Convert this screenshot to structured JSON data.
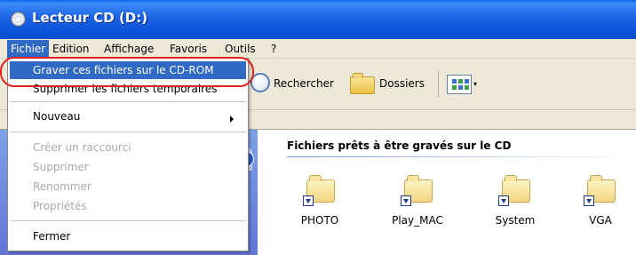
{
  "window": {
    "title": "Lecteur CD (D:)"
  },
  "menubar": {
    "items": [
      {
        "label": "Fichier"
      },
      {
        "label": "Edition"
      },
      {
        "label": "Affichage"
      },
      {
        "label": "Favoris"
      },
      {
        "label": "Outils"
      },
      {
        "label": "?"
      }
    ]
  },
  "toolbar": {
    "search_label": "Rechercher",
    "folders_label": "Dossiers",
    "views_arrow": "▾"
  },
  "content": {
    "section_title": "Fichiers prêts à être gravés sur le CD",
    "folders": [
      {
        "label": "PHOTO"
      },
      {
        "label": "Play_MAC"
      },
      {
        "label": "System"
      },
      {
        "label": "VGA"
      }
    ]
  },
  "dropdown": {
    "items": [
      {
        "label": "Graver ces fichiers sur le CD-ROM"
      },
      {
        "label": "Supprimer les fichiers temporaires"
      },
      {
        "label": "Nouveau"
      },
      {
        "label": "Créer un raccourci"
      },
      {
        "label": "Supprimer"
      },
      {
        "label": "Renommer"
      },
      {
        "label": "Propriétés"
      },
      {
        "label": "Fermer"
      }
    ],
    "submenu_arrow": "▶"
  },
  "colors": {
    "titlebar": "#0852d6",
    "selection": "#316ac5",
    "highlight": "#e02020"
  }
}
